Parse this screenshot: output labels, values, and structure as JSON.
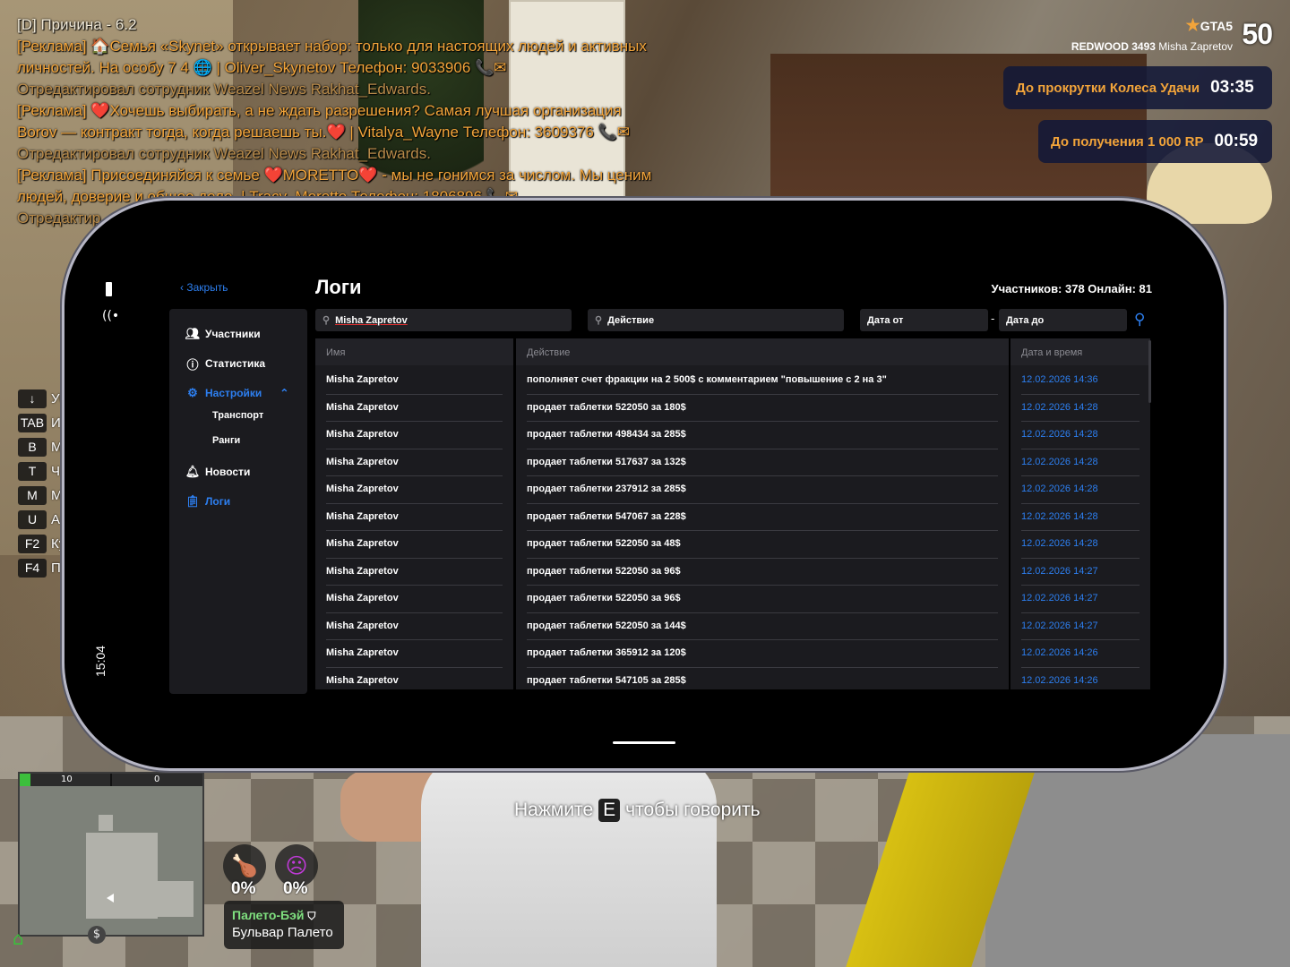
{
  "chat": [
    {
      "segments": [
        {
          "t": "[D] Причина - 6.2",
          "c": "white"
        }
      ]
    },
    {
      "segments": [
        {
          "t": "[Реклама] 🏠Семья «Skynet» открывает набор: только для настоящих людей и активных",
          "c": "orange"
        }
      ]
    },
    {
      "segments": [
        {
          "t": "личностей. На особу 7 4 🌐 | Oliver_Skynetov Телефон: 9033906 📞✉",
          "c": "orange"
        }
      ]
    },
    {
      "segments": [
        {
          "t": "Отредактировал сотрудник Weazel News Rakhat_Edwards.",
          "c": "gray"
        }
      ]
    },
    {
      "segments": [
        {
          "t": "[Реклама] ❤️Хочешь выбирать, а не ждать разрешения? Самая лучшая организация",
          "c": "orange"
        }
      ]
    },
    {
      "segments": [
        {
          "t": "Borov — контракт тогда, когда решаешь ты.❤️ | Vitalya_Wayne Телефон: 3609376 📞✉",
          "c": "orange"
        }
      ]
    },
    {
      "segments": [
        {
          "t": "Отредактировал сотрудник Weazel News Rakhat_Edwards.",
          "c": "gray"
        }
      ]
    },
    {
      "segments": [
        {
          "t": "[Реклама] Присоединяйся к семье ❤️MORETTO❤️ - мы не гонимся за числом. Мы ценим",
          "c": "orange"
        }
      ]
    },
    {
      "segments": [
        {
          "t": "людей, доверие и общее дело. | Tracy_Moretto Телефон: 1806896 📞✉",
          "c": "orange"
        }
      ]
    },
    {
      "segments": [
        {
          "t": "Отредактир",
          "c": "gray"
        }
      ]
    }
  ],
  "server": {
    "name": "GTA5",
    "number": "50",
    "city": "REDWOOD 3493",
    "player": "Misha Zapretov"
  },
  "timers": [
    {
      "label": "До прокрутки Колеса Удачи",
      "value": "03:35"
    },
    {
      "label": "До получения 1 000 RP",
      "value": "00:59"
    }
  ],
  "keys": [
    {
      "k": "↓",
      "t": "Уб"
    },
    {
      "k": "TAB",
      "t": "И"
    },
    {
      "k": "B",
      "t": "Ми"
    },
    {
      "k": "T",
      "t": "Ча"
    },
    {
      "k": "M",
      "t": "Ме"
    },
    {
      "k": "U",
      "t": "Ан"
    },
    {
      "k": "F2",
      "t": "Ку"
    },
    {
      "k": "F4",
      "t": "По"
    }
  ],
  "minimap": {
    "left_value": "10",
    "right_value": "0"
  },
  "stats": {
    "food": "0%",
    "mood": "0%"
  },
  "location": {
    "area": "Палето-Бэй",
    "street": "Бульвар Палето"
  },
  "prompt": {
    "before": "Нажмите",
    "key": "E",
    "after": "чтобы говорить"
  },
  "phone": {
    "time": "15:04",
    "close_label": "Закрыть",
    "title": "Логи",
    "counts": "Участников: 378  Онлайн: 81",
    "nav": {
      "members": "Участники",
      "stats": "Статистика",
      "settings": "Настройки",
      "transport": "Транспорт",
      "ranks": "Ранги",
      "news": "Новости",
      "logs": "Логи"
    },
    "filters": {
      "name_value": "Misha Zapretov",
      "action_placeholder": "Действие",
      "date_from": "Дата от",
      "date_to": "Дата до"
    },
    "columns": {
      "name": "Имя",
      "action": "Действие",
      "date": "Дата и время"
    },
    "rows": [
      {
        "name": "Misha Zapretov",
        "action": "пополняет счет фракции на 2 500$ с комментарием \"повышение с 2 на 3\"",
        "date": "12.02.2026 14:36"
      },
      {
        "name": "Misha Zapretov",
        "action": "продает таблетки 522050 за 180$",
        "date": "12.02.2026 14:28"
      },
      {
        "name": "Misha Zapretov",
        "action": "продает таблетки 498434 за 285$",
        "date": "12.02.2026 14:28"
      },
      {
        "name": "Misha Zapretov",
        "action": "продает таблетки 517637 за 132$",
        "date": "12.02.2026 14:28"
      },
      {
        "name": "Misha Zapretov",
        "action": "продает таблетки 237912 за 285$",
        "date": "12.02.2026 14:28"
      },
      {
        "name": "Misha Zapretov",
        "action": "продает таблетки 547067 за 228$",
        "date": "12.02.2026 14:28"
      },
      {
        "name": "Misha Zapretov",
        "action": "продает таблетки 522050 за 48$",
        "date": "12.02.2026 14:28"
      },
      {
        "name": "Misha Zapretov",
        "action": "продает таблетки 522050 за 96$",
        "date": "12.02.2026 14:27"
      },
      {
        "name": "Misha Zapretov",
        "action": "продает таблетки 522050 за 96$",
        "date": "12.02.2026 14:27"
      },
      {
        "name": "Misha Zapretov",
        "action": "продает таблетки 522050 за 144$",
        "date": "12.02.2026 14:27"
      },
      {
        "name": "Misha Zapretov",
        "action": "продает таблетки 365912 за 120$",
        "date": "12.02.2026 14:26"
      },
      {
        "name": "Misha Zapretov",
        "action": "продает таблетки 547105 за 285$",
        "date": "12.02.2026 14:26"
      }
    ]
  },
  "colors": {
    "accent": "#2d7ff0",
    "chat_orange": "#f2a43a",
    "timer_bg": "#121838"
  }
}
